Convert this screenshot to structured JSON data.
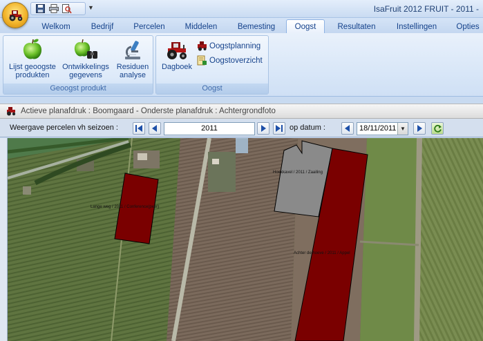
{
  "title": {
    "text": "IsaFruit 2012   FRUIT   -  2011  -"
  },
  "tabs": [
    {
      "label": "Welkom"
    },
    {
      "label": "Bedrijf"
    },
    {
      "label": "Percelen"
    },
    {
      "label": "Middelen"
    },
    {
      "label": "Bemesting"
    },
    {
      "label": "Oogst"
    },
    {
      "label": "Resultaten"
    },
    {
      "label": "Instellingen"
    },
    {
      "label": "Opties"
    }
  ],
  "active_tab": "Oogst",
  "ribbon": {
    "groups": [
      {
        "caption": "Geoogst produkt",
        "buttons": [
          {
            "label": "Lijst geoogste produkten",
            "icon": "green-apple-icon"
          },
          {
            "label": "Ontwikkelings gegevens",
            "icon": "apple-binoculars-icon"
          },
          {
            "label": "Residuen analyse",
            "icon": "microscope-icon"
          }
        ]
      },
      {
        "caption": "Oogst",
        "buttons": [
          {
            "label": "Dagboek",
            "icon": "tractor-icon"
          },
          {
            "label": "Oogstplanning",
            "icon": "planning-icon"
          },
          {
            "label": "Oogstoverzicht",
            "icon": "overview-icon"
          }
        ]
      }
    ]
  },
  "panel": {
    "header": "Actieve planafdruk : Boomgaard - Onderste planafdruk : Achtergrondfoto"
  },
  "toolbar": {
    "season_label": "Weergave percelen vh seizoen :",
    "season_value": "2011",
    "date_label": "op datum :",
    "date_value": "18/11/2011"
  },
  "map": {
    "parcels": [
      {
        "label": "Lange weg / 2011 / Conference(peer)",
        "color": "#7a0000"
      },
      {
        "label": "Hoekkavel / 2011 / Zaailing",
        "color": "#8a8a8a"
      },
      {
        "label": "Achter de hoeve / 2011 / Appel",
        "color": "#7a0000"
      }
    ]
  },
  "colors": {
    "parcel_red": "#7a0000",
    "parcel_grey": "#8a8a8a",
    "ribbon_blue": "#15428b"
  }
}
